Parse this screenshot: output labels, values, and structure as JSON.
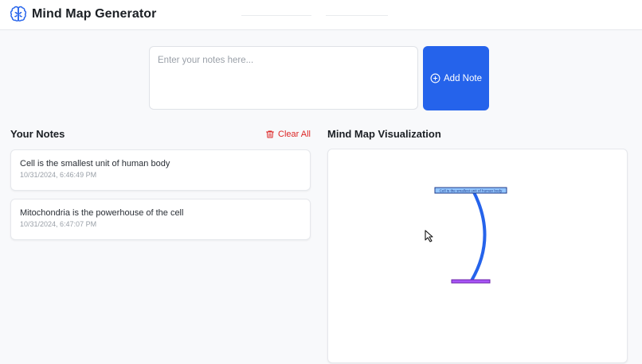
{
  "header": {
    "title": "Mind Map Generator",
    "logo_icon": "brain-icon"
  },
  "input": {
    "placeholder": "Enter your notes here...",
    "value": ""
  },
  "add_button": {
    "label": "Add Note",
    "icon": "plus-circle-icon",
    "color": "#2563eb"
  },
  "notes_section": {
    "title": "Your Notes",
    "clear_label": "Clear All",
    "clear_icon": "trash-icon",
    "clear_color": "#dc2626",
    "notes": [
      {
        "text": "Cell is the smallest unit of human body",
        "timestamp": "10/31/2024, 6:46:49 PM"
      },
      {
        "text": "Mitochondria is the powerhouse of the cell",
        "timestamp": "10/31/2024, 6:47:07 PM"
      }
    ]
  },
  "visualization": {
    "title": "Mind Map Visualization",
    "nodes": [
      {
        "label": "Cell is the smallest unit of human body",
        "color": "#93c5fd"
      },
      {
        "label": "",
        "color": "#a855f7"
      }
    ],
    "edge_color": "#2563eb"
  }
}
